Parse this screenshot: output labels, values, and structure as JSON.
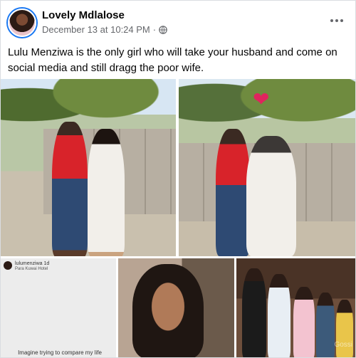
{
  "post": {
    "author": "Lovely Mdlalose",
    "timestamp": "December 13 at 10:24 PM",
    "separator": "·",
    "audience_icon": "globe-icon",
    "more_icon": "more-options-icon",
    "caption": "Lulu Menziwa is the only girl who will take your husband and come on social media and still dragg the poor wife."
  },
  "photos": {
    "story_username": "lulumenziwa",
    "story_time": "1d",
    "story_subtitle": "Para Kuwai Hotel",
    "story_caption": "Imagine trying to compare my life",
    "watermark": "Gossi"
  },
  "colors": {
    "accent": "#1877f2",
    "text_primary": "#050505",
    "text_secondary": "#65676b"
  }
}
